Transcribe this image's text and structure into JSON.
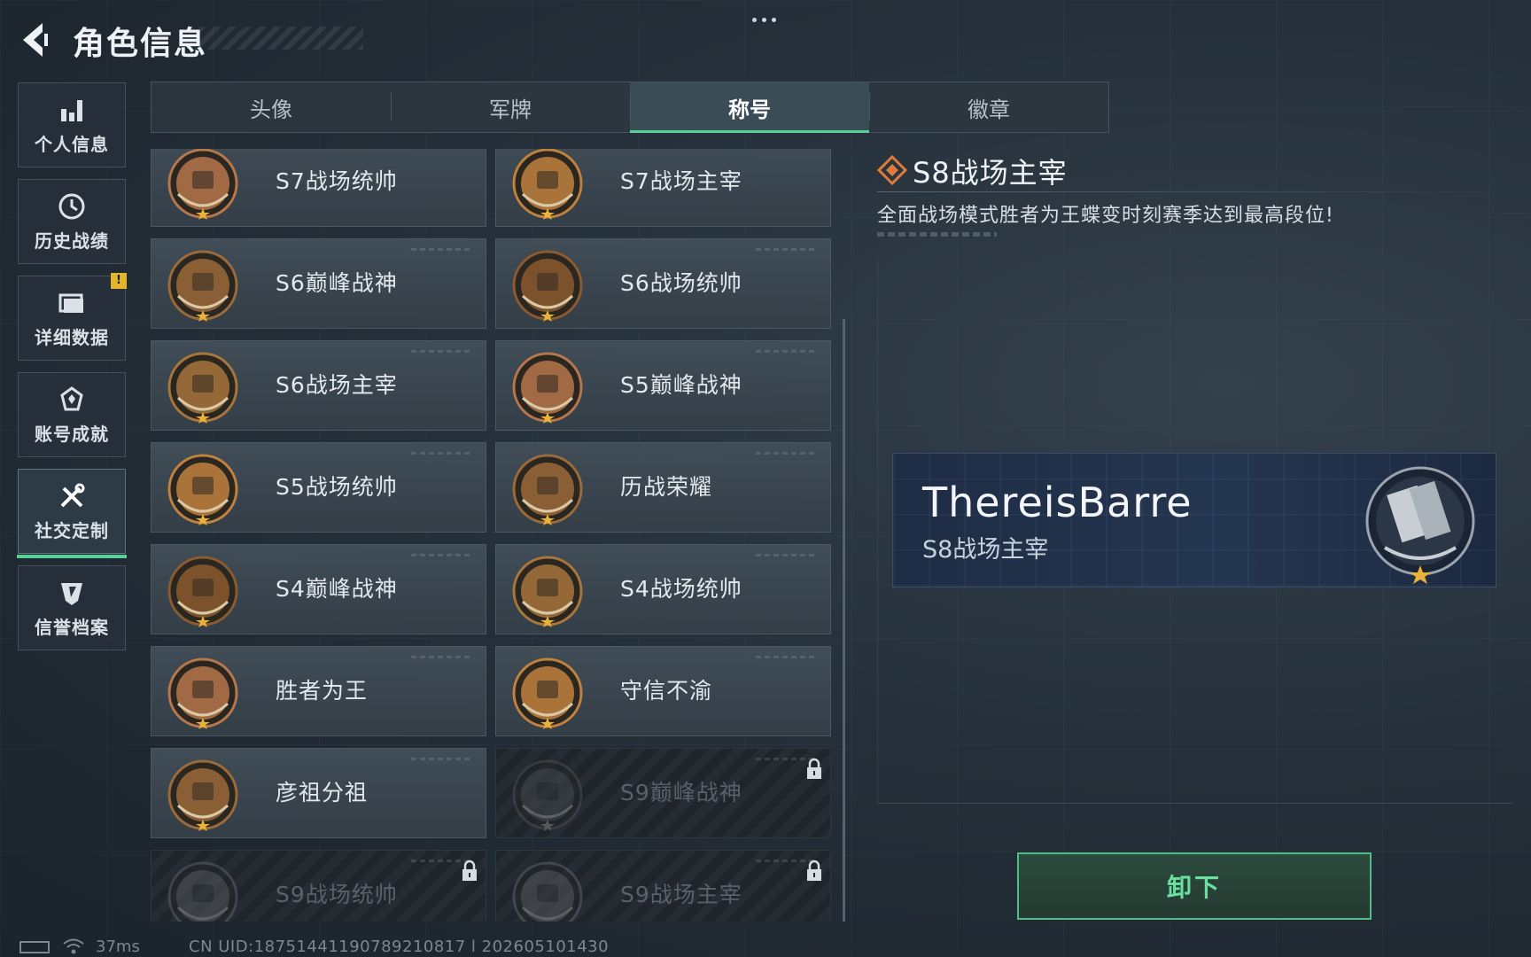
{
  "header": {
    "title": "角色信息"
  },
  "sidenav": {
    "items": [
      {
        "label": "个人信息",
        "icon": "bar-chart-icon"
      },
      {
        "label": "历史战绩",
        "icon": "history-clock-icon"
      },
      {
        "label": "详细数据",
        "icon": "folder-icon",
        "badge": "!"
      },
      {
        "label": "账号成就",
        "icon": "achievement-icon"
      },
      {
        "label": "社交定制",
        "icon": "tools-icon",
        "active": true
      },
      {
        "label": "信誉档案",
        "icon": "credit-shield-icon"
      }
    ]
  },
  "tabs": [
    {
      "label": "头像"
    },
    {
      "label": "军牌"
    },
    {
      "label": "称号",
      "active": true
    },
    {
      "label": "徽章"
    }
  ],
  "titles": [
    {
      "label": "S7战场统帅",
      "locked": false
    },
    {
      "label": "S7战场主宰",
      "locked": false
    },
    {
      "label": "S6巅峰战神",
      "locked": false
    },
    {
      "label": "S6战场统帅",
      "locked": false
    },
    {
      "label": "S6战场主宰",
      "locked": false
    },
    {
      "label": "S5巅峰战神",
      "locked": false
    },
    {
      "label": "S5战场统帅",
      "locked": false
    },
    {
      "label": "历战荣耀",
      "locked": false
    },
    {
      "label": "S4巅峰战神",
      "locked": false
    },
    {
      "label": "S4战场统帅",
      "locked": false
    },
    {
      "label": "胜者为王",
      "locked": false
    },
    {
      "label": "守信不渝",
      "locked": false
    },
    {
      "label": "彦祖分祖",
      "locked": false
    },
    {
      "label": "S9巅峰战神",
      "locked": true
    },
    {
      "label": "S9战场统帅",
      "locked": true
    },
    {
      "label": "S9战场主宰",
      "locked": true
    }
  ],
  "detail": {
    "title": "S8战场主宰",
    "description": "全面战场模式胜者为王蝶变时刻赛季达到最高段位!",
    "preview_name": "ThereisBarre",
    "preview_title": "S8战场主宰",
    "action_label": "卸下"
  },
  "status": {
    "ping": "37ms",
    "uid": "CN UID:18751441190789210817 l 202605101430"
  },
  "colors": {
    "accent": "#58d196",
    "badge": "#e3b62a",
    "title_icon": "#e07a3a"
  }
}
